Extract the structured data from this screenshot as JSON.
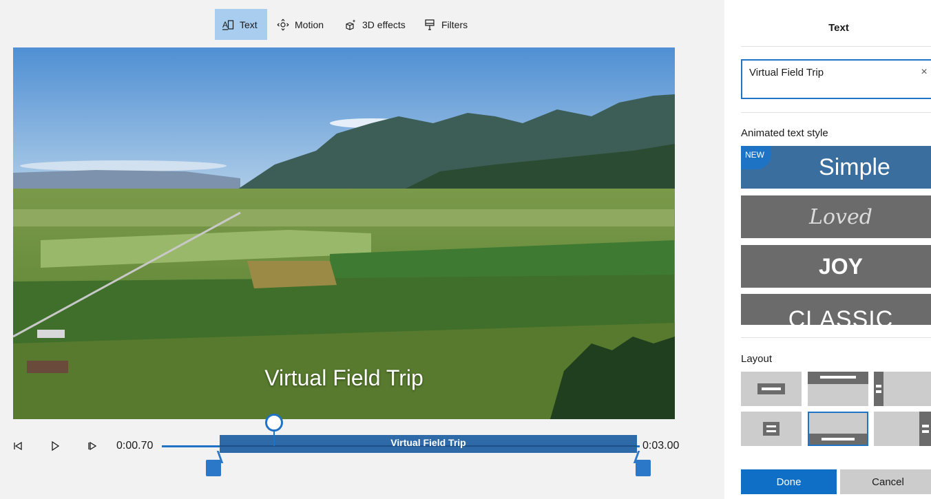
{
  "toolbar": {
    "tabs": [
      {
        "label": "Text",
        "icon": "text-box-icon",
        "active": true
      },
      {
        "label": "Motion",
        "icon": "motion-icon",
        "active": false
      },
      {
        "label": "3D effects",
        "icon": "3d-effects-icon",
        "active": false
      },
      {
        "label": "Filters",
        "icon": "filters-icon",
        "active": false
      }
    ]
  },
  "preview": {
    "overlay_text": "Virtual Field Trip"
  },
  "playback": {
    "current_time": "0:00.70",
    "total_time": "0:03.00",
    "clip_label": "Virtual Field Trip",
    "icons": [
      "previous-frame-icon",
      "play-icon",
      "next-frame-icon"
    ]
  },
  "panel": {
    "title": "Text",
    "text_value": "Virtual Field Trip",
    "clear_glyph": "×",
    "animated_style_label": "Animated text style",
    "styles": [
      {
        "label": "Simple",
        "badge": "NEW",
        "selected": true
      },
      {
        "label": "Loved"
      },
      {
        "label": "JOY"
      },
      {
        "label": "CLASSIC"
      }
    ],
    "layout_label": "Layout",
    "done_label": "Done",
    "cancel_label": "Cancel"
  },
  "colors": {
    "accent": "#1f73c5",
    "active_tab": "#a9cdee",
    "clip_bar": "#2e6aa8",
    "style_card": "#6b6b6b"
  }
}
